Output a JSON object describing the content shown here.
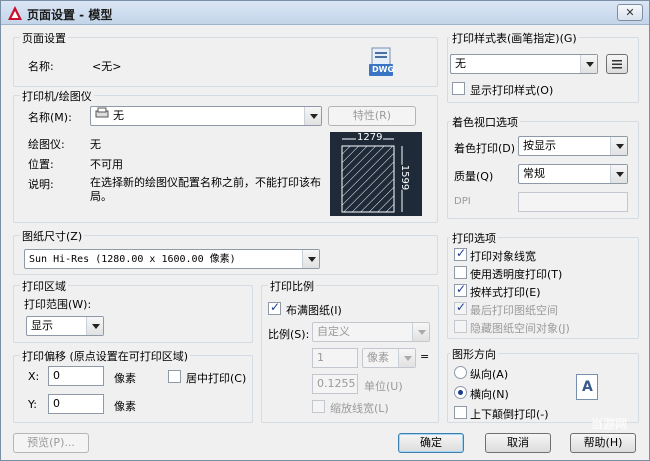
{
  "window": {
    "title": "页面设置 - 模型",
    "close_glyph": "✕"
  },
  "page_setup": {
    "legend": "页面设置",
    "name_label": "名称:",
    "name_value": "<无>",
    "dwg_label": "DWG"
  },
  "printer": {
    "legend": "打印机/绘图仪",
    "name_label": "名称(M):",
    "name_value": "无",
    "properties_button": "特性(R)",
    "plotter_label": "绘图仪:",
    "plotter_value": "无",
    "location_label": "位置:",
    "location_value": "不可用",
    "description_label": "说明:",
    "description_value": "在选择新的绘图仪配置名称之前，不能打印该布局。",
    "preview_width": "1279",
    "preview_height": "1599"
  },
  "paper_size": {
    "legend": "图纸尺寸(Z)",
    "value": "Sun Hi-Res (1280.00 x 1600.00 像素)"
  },
  "plot_area": {
    "legend": "打印区域",
    "range_label": "打印范围(W):",
    "range_value": "显示"
  },
  "plot_offset": {
    "legend": "打印偏移 (原点设置在可打印区域)",
    "x_label": "X:",
    "x_value": "0",
    "x_unit": "像素",
    "y_label": "Y:",
    "y_value": "0",
    "y_unit": "像素",
    "center_label": "居中打印(C)"
  },
  "plot_scale": {
    "legend": "打印比例",
    "fit_label": "布满图纸(I)",
    "scale_label": "比例(S):",
    "scale_value": "自定义",
    "scale_num": "1",
    "unit_value": "像素",
    "equals": "=",
    "scale_den": "0.1255",
    "unit_label": "单位(U)",
    "lineweight_label": "缩放线宽(L)"
  },
  "plot_style_table": {
    "legend": "打印样式表(画笔指定)(G)",
    "value": "无",
    "show_label": "显示打印样式(O)"
  },
  "shaded_viewport": {
    "legend": "着色视口选项",
    "shade_label": "着色打印(D)",
    "shade_value": "按显示",
    "quality_label": "质量(Q)",
    "quality_value": "常规",
    "dpi_label": "DPI"
  },
  "plot_options": {
    "legend": "打印选项",
    "items": [
      {
        "label": "打印对象线宽"
      },
      {
        "label": "使用透明度打印(T)"
      },
      {
        "label": "按样式打印(E)"
      },
      {
        "label": "最后打印图纸空间"
      },
      {
        "label": "隐藏图纸空间对象(J)"
      }
    ]
  },
  "orientation": {
    "legend": "图形方向",
    "portrait": "纵向(A)",
    "landscape": "横向(N)",
    "upside_down": "上下颠倒打印(-)",
    "icon_letter": "A"
  },
  "footer": {
    "preview": "预览(P)...",
    "ok": "确定",
    "cancel": "取消",
    "help": "帮助(H)"
  },
  "watermark": "当游网"
}
